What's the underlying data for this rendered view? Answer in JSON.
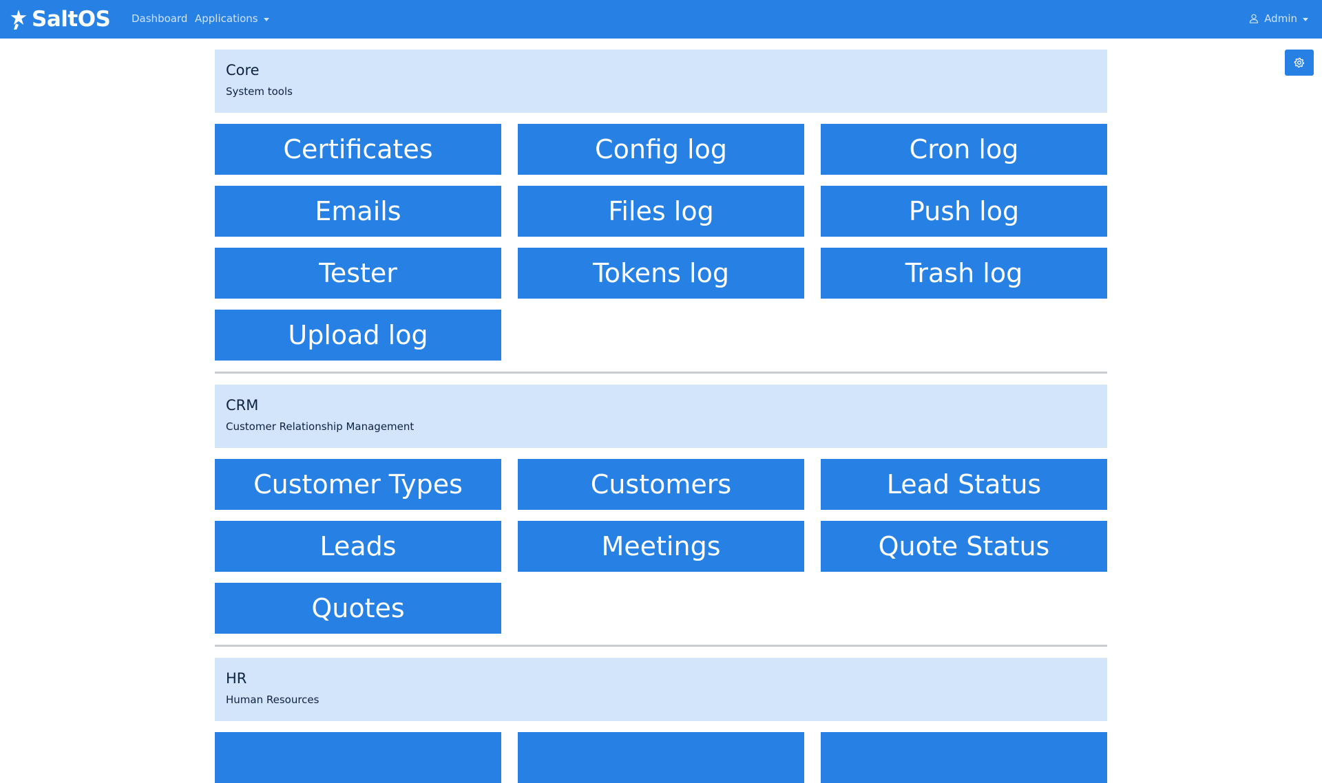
{
  "navbar": {
    "brand": "SaltOS",
    "brand_icon": "saltos-star-figure-icon",
    "links": {
      "dashboard": "Dashboard",
      "applications": "Applications"
    },
    "user": "Admin",
    "user_icon": "person-icon"
  },
  "settings_button": {
    "icon": "gear-icon"
  },
  "sections": [
    {
      "title": "Core",
      "subtitle": "System tools",
      "apps": [
        "Certificates",
        "Config log",
        "Cron log",
        "Emails",
        "Files log",
        "Push log",
        "Tester",
        "Tokens log",
        "Trash log",
        "Upload log"
      ]
    },
    {
      "title": "CRM",
      "subtitle": "Customer Relationship Management",
      "apps": [
        "Customer Types",
        "Customers",
        "Lead Status",
        "Leads",
        "Meetings",
        "Quote Status",
        "Quotes"
      ]
    },
    {
      "title": "HR",
      "subtitle": "Human Resources",
      "apps": [
        "",
        "",
        ""
      ]
    }
  ],
  "colors": {
    "primary": "#2781e5",
    "section_header_bg": "#d3e5fa",
    "divider": "#c8cdd2"
  }
}
